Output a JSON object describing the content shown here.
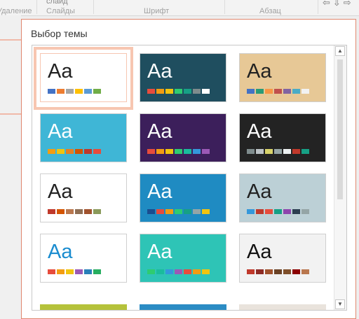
{
  "ribbon": {
    "slide_label": "слайд",
    "groups": [
      "Удаление",
      "Слайды",
      "Шрифт",
      "Абзац"
    ]
  },
  "dialog": {
    "title": "Выбор темы",
    "themes": [
      {
        "label": "Aa",
        "bg": "#ffffff",
        "text": "#222222",
        "swatches": [
          "#4472c4",
          "#ed7d31",
          "#a5a5a5",
          "#ffc000",
          "#5b9bd5",
          "#70ad47"
        ],
        "selected": true
      },
      {
        "label": "Aa",
        "bg": "#1f4e5f",
        "text": "#ffffff",
        "swatches": [
          "#e84c3d",
          "#f39c12",
          "#f1c40f",
          "#2ecc71",
          "#16a085",
          "#7f8c8d",
          "#ffffff"
        ]
      },
      {
        "label": "Aa",
        "bg": "#e7c896",
        "text": "#222222",
        "swatches": [
          "#4472c4",
          "#2a9b77",
          "#f79646",
          "#c0504d",
          "#8064a2",
          "#4bacc6",
          "#f2f2f2"
        ]
      },
      {
        "label": "Aa",
        "bg": "#3fb6d6",
        "text": "#ffffff",
        "swatches": [
          "#f39c12",
          "#f1c40f",
          "#e67e22",
          "#d35400",
          "#c0392b",
          "#e74c3c"
        ]
      },
      {
        "label": "Aa",
        "bg": "#3c1f5b",
        "text": "#ffffff",
        "swatches": [
          "#e74c3c",
          "#f39c12",
          "#f1c40f",
          "#2ecc71",
          "#1abc9c",
          "#3498db",
          "#9b59b6"
        ]
      },
      {
        "label": "Aa",
        "bg": "#232323",
        "text": "#ffffff",
        "swatches": [
          "#7f8c8d",
          "#bdc3c7",
          "#d8d36b",
          "#95a5a6",
          "#ecf0f1",
          "#c0392b",
          "#16a085"
        ]
      },
      {
        "label": "Aa",
        "bg": "#ffffff",
        "text": "#222222",
        "swatches": [
          "#c0392b",
          "#d35400",
          "#b9774e",
          "#8e6e53",
          "#a0522d",
          "#8a9a5b"
        ]
      },
      {
        "label": "Aa",
        "bg": "#1f8bc2",
        "text": "#ffffff",
        "swatches": [
          "#1a4d8f",
          "#e74c3c",
          "#f39c12",
          "#2ecc71",
          "#16a085",
          "#95a5a6",
          "#f1c40f"
        ]
      },
      {
        "label": "Aa",
        "bg": "#bcd0d6",
        "text": "#222222",
        "swatches": [
          "#3498db",
          "#c0392b",
          "#e74c3c",
          "#16a085",
          "#8e44ad",
          "#2c3e50",
          "#95a5a6"
        ]
      },
      {
        "label": "Aa",
        "bg": "#ffffff",
        "text": "#1a8ccf",
        "swatches": [
          "#e74c3c",
          "#f39c12",
          "#f1c40f",
          "#9b59b6",
          "#2980b9",
          "#27ae60"
        ]
      },
      {
        "label": "Aa",
        "bg": "#2ec4b6",
        "text": "#ffffff",
        "swatches": [
          "#2ecc71",
          "#1abc9c",
          "#3498db",
          "#9b59b6",
          "#e74c3c",
          "#f39c12",
          "#f1c40f"
        ]
      },
      {
        "label": "Aa",
        "bg": "#f2f2f2",
        "text": "#111111",
        "swatches": [
          "#c0392b",
          "#8e2b25",
          "#a0522d",
          "#6b4226",
          "#7f4f2a",
          "#8b0000",
          "#b9774e"
        ]
      }
    ],
    "partial_row_colors": [
      "#b5c23b",
      "#2b8cc4",
      "#e9e3dc"
    ]
  },
  "scroll": {
    "up_icon": "▲",
    "down_icon": "▼"
  }
}
